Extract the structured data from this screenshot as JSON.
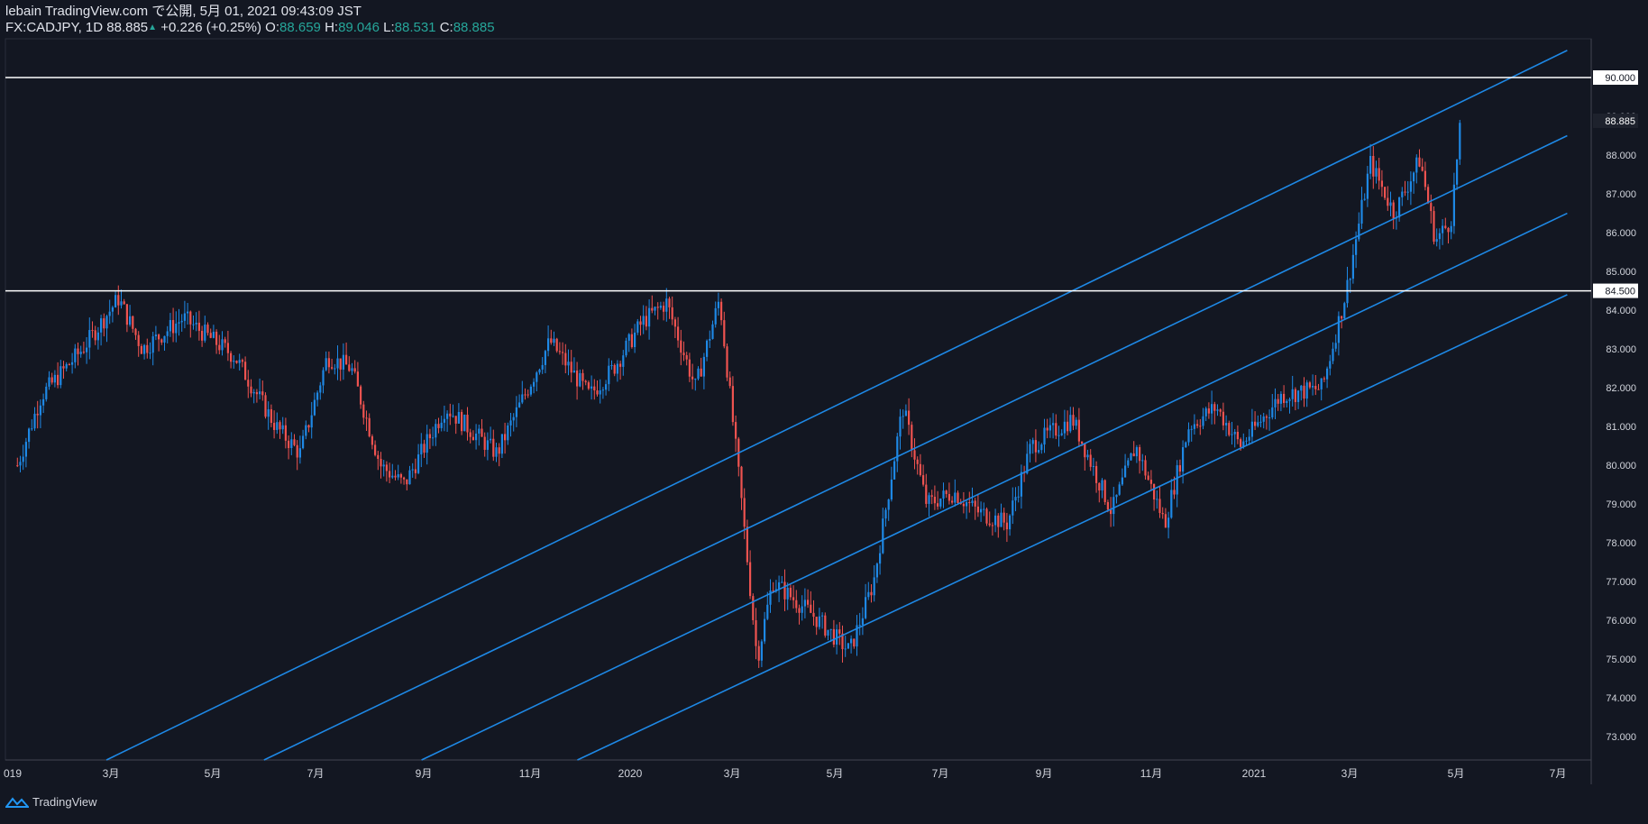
{
  "header": {
    "publish": "lebain TradingView.com で公開, 5月 01, 2021 09:43:09 JST",
    "symbol": "FX:CADJPY, 1D",
    "last": "88.885",
    "arrow": "▲",
    "change": "+0.226 (+0.25%)",
    "o_label": "O:",
    "o": "88.659",
    "h_label": "H:",
    "h": "89.046",
    "l_label": "L:",
    "l": "88.531",
    "c_label": "C:",
    "c": "88.885"
  },
  "footer": {
    "brand": "TradingView"
  },
  "colors": {
    "bg": "#131722",
    "up": "#2962ff",
    "up_alt": "#1e88e5",
    "down": "#ef5350",
    "channel": "#1e88e5",
    "hline": "#ffffff",
    "text": "#d1d4dc",
    "header_up": "#26a69a"
  },
  "chart_data": {
    "type": "candlestick",
    "symbol": "FX:CADJPY",
    "interval": "1D",
    "ylim": [
      72.4,
      91.0
    ],
    "y_ticks": [
      "73.000",
      "74.000",
      "75.000",
      "76.000",
      "77.000",
      "78.000",
      "79.000",
      "80.000",
      "81.000",
      "82.000",
      "83.000",
      "84.000",
      "85.000",
      "86.000",
      "87.000",
      "88.000",
      "89.000",
      "90.000"
    ],
    "x_tick_labels": [
      "019",
      "3月",
      "5月",
      "7月",
      "9月",
      "11月",
      "2020",
      "3月",
      "5月",
      "7月",
      "9月",
      "11月",
      "2021",
      "3月",
      "5月",
      "7月"
    ],
    "price_path": [
      {
        "x": "2019-01",
        "y": 80.0
      },
      {
        "x": "2019-01",
        "y": 81.8
      },
      {
        "x": "2019-02",
        "y": 83.0
      },
      {
        "x": "2019-03",
        "y": 84.3
      },
      {
        "x": "2019-03",
        "y": 83.0
      },
      {
        "x": "2019-04",
        "y": 83.8
      },
      {
        "x": "2019-05",
        "y": 82.8
      },
      {
        "x": "2019-06",
        "y": 81.0
      },
      {
        "x": "2019-06",
        "y": 80.3
      },
      {
        "x": "2019-07",
        "y": 82.8
      },
      {
        "x": "2019-07",
        "y": 82.5
      },
      {
        "x": "2019-08",
        "y": 80.0
      },
      {
        "x": "2019-08",
        "y": 79.5
      },
      {
        "x": "2019-09",
        "y": 81.5
      },
      {
        "x": "2019-10",
        "y": 80.3
      },
      {
        "x": "2019-11",
        "y": 83.2
      },
      {
        "x": "2019-12",
        "y": 81.8
      },
      {
        "x": "2019-12",
        "y": 82.5
      },
      {
        "x": "2020-01",
        "y": 83.7
      },
      {
        "x": "2020-01",
        "y": 84.2
      },
      {
        "x": "2020-02",
        "y": 82.0
      },
      {
        "x": "2020-02",
        "y": 84.3
      },
      {
        "x": "2020-03",
        "y": 79.0
      },
      {
        "x": "2020-03",
        "y": 75.0
      },
      {
        "x": "2020-03",
        "y": 77.0
      },
      {
        "x": "2020-04",
        "y": 76.2
      },
      {
        "x": "2020-05",
        "y": 75.2
      },
      {
        "x": "2020-05",
        "y": 77.0
      },
      {
        "x": "2020-06",
        "y": 81.5
      },
      {
        "x": "2020-06",
        "y": 79.0
      },
      {
        "x": "2020-07",
        "y": 79.3
      },
      {
        "x": "2020-07",
        "y": 78.8
      },
      {
        "x": "2020-08",
        "y": 78.5
      },
      {
        "x": "2020-08",
        "y": 80.5
      },
      {
        "x": "2020-09",
        "y": 81.2
      },
      {
        "x": "2020-10",
        "y": 78.8
      },
      {
        "x": "2020-10",
        "y": 80.5
      },
      {
        "x": "2020-11",
        "y": 78.5
      },
      {
        "x": "2020-11",
        "y": 81.0
      },
      {
        "x": "2020-12",
        "y": 81.5
      },
      {
        "x": "2020-12",
        "y": 80.5
      },
      {
        "x": "2021-01",
        "y": 81.8
      },
      {
        "x": "2021-02",
        "y": 82.0
      },
      {
        "x": "2021-02",
        "y": 84.5
      },
      {
        "x": "2021-03",
        "y": 87.8
      },
      {
        "x": "2021-03",
        "y": 86.5
      },
      {
        "x": "2021-04",
        "y": 87.9
      },
      {
        "x": "2021-04",
        "y": 85.8
      },
      {
        "x": "2021-04",
        "y": 86.3
      },
      {
        "x": "2021-04-30",
        "y": 88.885
      }
    ],
    "horizontal_lines": [
      {
        "price": 90.0,
        "label": "90.000"
      },
      {
        "price": 84.5,
        "label": "84.500"
      }
    ],
    "channel_lines": [
      {
        "x1": "2019-03",
        "y1": 72.4,
        "x2": "2021-07",
        "y2": 90.7
      },
      {
        "x1": "2019-06",
        "y1": 72.4,
        "x2": "2021-07",
        "y2": 88.5
      },
      {
        "x1": "2019-09",
        "y1": 72.4,
        "x2": "2021-07",
        "y2": 86.5
      },
      {
        "x1": "2019-12",
        "y1": 72.4,
        "x2": "2021-07",
        "y2": 84.4
      }
    ],
    "last_price_label": "88.885"
  }
}
